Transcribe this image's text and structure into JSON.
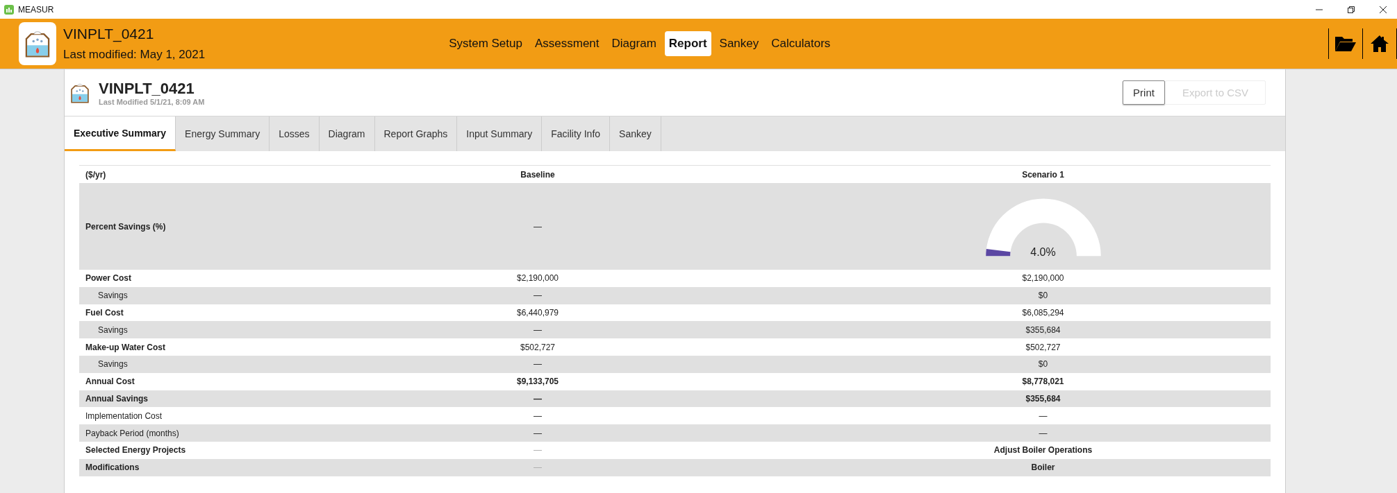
{
  "window": {
    "title": "MEASUR"
  },
  "header": {
    "title": "VINPLT_0421",
    "subtitle": "Last modified: May 1, 2021",
    "nav": [
      {
        "label": "System Setup",
        "selected": false
      },
      {
        "label": "Assessment",
        "selected": false
      },
      {
        "label": "Diagram",
        "selected": false
      },
      {
        "label": "Report",
        "selected": true
      },
      {
        "label": "Sankey",
        "selected": false
      },
      {
        "label": "Calculators",
        "selected": false
      }
    ]
  },
  "report": {
    "title": "VINPLT_0421",
    "subtitle": "Last Modified 5/1/21, 8:09 AM",
    "buttons": [
      {
        "label": "Print",
        "disabled": false
      },
      {
        "label": "Export to CSV",
        "disabled": true
      }
    ],
    "tabs": [
      {
        "label": "Executive Summary",
        "selected": true
      },
      {
        "label": "Energy Summary",
        "selected": false
      },
      {
        "label": "Losses",
        "selected": false
      },
      {
        "label": "Diagram",
        "selected": false
      },
      {
        "label": "Report Graphs",
        "selected": false
      },
      {
        "label": "Input Summary",
        "selected": false
      },
      {
        "label": "Facility Info",
        "selected": false
      },
      {
        "label": "Sankey",
        "selected": false
      }
    ]
  },
  "table": {
    "columns": [
      "($/yr)",
      "Baseline",
      "Scenario 1"
    ],
    "percent_row": {
      "label": "Percent Savings (%)",
      "baseline": "—",
      "level": 0.04,
      "reading": "4.0%"
    },
    "rows": [
      {
        "kind": "cost",
        "label": "Power Cost",
        "baseline": "$2,190,000",
        "scenario": "$2,190,000"
      },
      {
        "kind": "savings",
        "label": "Savings",
        "baseline": "—",
        "scenario": "$0"
      },
      {
        "kind": "cost",
        "label": "Fuel Cost",
        "baseline": "$6,440,979",
        "scenario": "$6,085,294"
      },
      {
        "kind": "savings",
        "label": "Savings",
        "baseline": "—",
        "scenario": "$355,684"
      },
      {
        "kind": "cost",
        "label": "Make-up Water Cost",
        "baseline": "$502,727",
        "scenario": "$502,727"
      },
      {
        "kind": "savings",
        "label": "Savings",
        "baseline": "—",
        "scenario": "$0"
      },
      {
        "kind": "total",
        "label": "Annual Cost",
        "baseline": "$9,133,705",
        "scenario": "$8,778,021"
      },
      {
        "kind": "total",
        "label": "Annual Savings",
        "baseline": "—",
        "scenario": "$355,684"
      },
      {
        "kind": "plain",
        "label": "Implementation Cost",
        "baseline": "—",
        "scenario": "—"
      },
      {
        "kind": "plain",
        "label": "Payback Period (months)",
        "baseline": "—",
        "scenario": "—"
      },
      {
        "kind": "project",
        "label": "Selected Energy Projects",
        "baseline": "—",
        "scenario": "Adjust Boiler Operations"
      },
      {
        "kind": "project",
        "label": "Modifications",
        "baseline": "—",
        "scenario": "Boiler"
      }
    ]
  }
}
